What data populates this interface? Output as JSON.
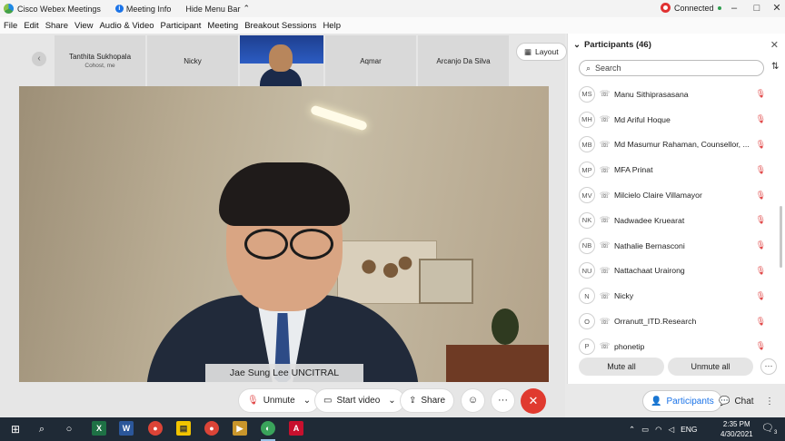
{
  "titlebar": {
    "app_name": "Cisco Webex Meetings",
    "meeting_info": "Meeting Info",
    "hide_menu": "Hide Menu Bar",
    "status": "Connected",
    "minimize": "–",
    "maximize": "□",
    "close": "✕"
  },
  "menu": [
    "File",
    "Edit",
    "Share",
    "View",
    "Audio & Video",
    "Participant",
    "Meeting",
    "Breakout Sessions",
    "Help"
  ],
  "thumbnails": [
    {
      "name": "Tanthita Sukhopala",
      "sub": "Cohost, me"
    },
    {
      "name": "Nicky",
      "sub": ""
    },
    {
      "name": "",
      "sub": ""
    },
    {
      "name": "Aqmar",
      "sub": ""
    },
    {
      "name": "Arcanjo Da Silva",
      "sub": ""
    }
  ],
  "layout_label": "Layout",
  "speaker_name": "Jae Sung Lee UNCITRAL",
  "controls": {
    "unmute": "Unmute",
    "start_video": "Start video",
    "share": "Share",
    "more": "···",
    "end": "✕"
  },
  "panel": {
    "title": "Participants (46)",
    "search_placeholder": "Search",
    "participants": [
      {
        "initials": "MS",
        "name": "Manu Sithiprasasana"
      },
      {
        "initials": "MH",
        "name": "Md Ariful Hoque"
      },
      {
        "initials": "MB",
        "name": "Md Masumur Rahaman, Counsellor, ..."
      },
      {
        "initials": "MP",
        "name": "MFA Prinat"
      },
      {
        "initials": "MV",
        "name": "Milcielo Claire Villamayor"
      },
      {
        "initials": "NK",
        "name": "Nadwadee Kruearat"
      },
      {
        "initials": "NB",
        "name": "Nathalie Bernasconi"
      },
      {
        "initials": "NU",
        "name": "Nattachaat Urairong"
      },
      {
        "initials": "N",
        "name": "Nicky"
      },
      {
        "initials": "O",
        "name": "Orranutt_ITD.Research"
      },
      {
        "initials": "P",
        "name": "phonetip"
      }
    ],
    "mute_all": "Mute all",
    "unmute_all": "Unmute all",
    "more": "···"
  },
  "right_controls": {
    "participants": "Participants",
    "chat": "Chat",
    "more": "⋮"
  },
  "taskbar": {
    "lang": "ENG",
    "time": "2:35 PM",
    "date": "4/30/2021",
    "notif_count": "3"
  },
  "colors": {
    "accent": "#1a73e8",
    "danger": "#e03a2f",
    "taskbar": "#1f2a36"
  }
}
